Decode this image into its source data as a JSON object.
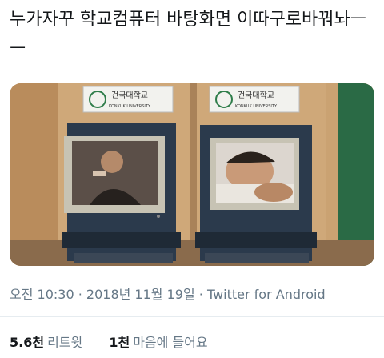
{
  "tweet": {
    "text": "누가자꾸 학교컴퓨터 바탕화면 이따구로바꿔놔ㅡㅡ"
  },
  "media": {
    "signs": [
      {
        "korean": "건국대학교",
        "english": "KONKUK UNIVERSITY"
      },
      {
        "korean": "건국대학교",
        "english": "KONKUK UNIVERSITY"
      }
    ]
  },
  "meta": {
    "time": "오전 10:30",
    "separator1": " · ",
    "date": "2018년 11월 19일",
    "separator2": " · ",
    "source": "Twitter for Android"
  },
  "stats": {
    "retweets_count": "5.6천",
    "retweets_label": "리트윗",
    "likes_count": "1천",
    "likes_label": "마음에 들어요"
  },
  "colors": {
    "text": "#14171a",
    "secondary": "#657786",
    "divider": "#e6ecf0"
  }
}
